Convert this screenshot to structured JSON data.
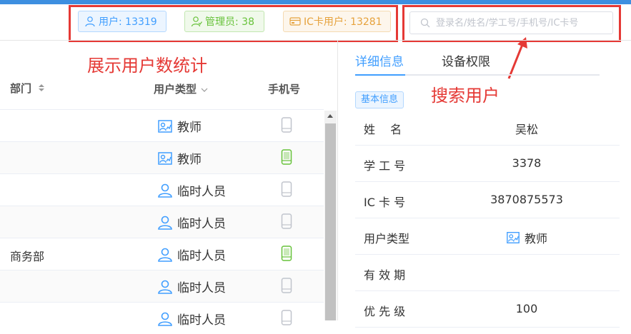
{
  "stats": {
    "users": "用户: 13319",
    "admins": "管理员: 38",
    "ic_users": "IC卡用户: 13281"
  },
  "search": {
    "placeholder": "登录名/姓名/学工号/手机号/IC卡号"
  },
  "annotations": {
    "stats_note": "展示用户数统计",
    "search_note": "搜索用户"
  },
  "table": {
    "headers": {
      "dept": "部门",
      "user_type": "用户类型",
      "phone": "手机号"
    },
    "rows": [
      {
        "dept": "",
        "type": "教师",
        "phone_state": "inactive"
      },
      {
        "dept": "",
        "type": "教师",
        "phone_state": "active"
      },
      {
        "dept": "",
        "type": "临时人员",
        "phone_state": "inactive"
      },
      {
        "dept": "",
        "type": "临时人员",
        "phone_state": "inactive"
      },
      {
        "dept": "商务部",
        "type": "临时人员",
        "phone_state": "active"
      },
      {
        "dept": "",
        "type": "临时人员",
        "phone_state": "inactive"
      },
      {
        "dept": "",
        "type": "临时人员",
        "phone_state": "inactive"
      }
    ]
  },
  "detail": {
    "tabs": [
      "详细信息",
      "设备权限"
    ],
    "section_badge": "基本信息",
    "fields": [
      {
        "label": "姓　 名",
        "value": "吴松"
      },
      {
        "label": "学 工 号",
        "value": "3378"
      },
      {
        "label": "IC 卡 号",
        "value": "3870875573"
      },
      {
        "label": "用户类型",
        "value": "教师"
      },
      {
        "label": "有 效 期",
        "value": ""
      },
      {
        "label": "优 先 级",
        "value": "100"
      }
    ]
  },
  "colors": {
    "primary": "#409eff",
    "success": "#67c23a",
    "warning": "#e6a23c",
    "annotation_red": "#e53935",
    "phone_active": "#67c23a",
    "phone_inactive": "#c0c4cc"
  }
}
